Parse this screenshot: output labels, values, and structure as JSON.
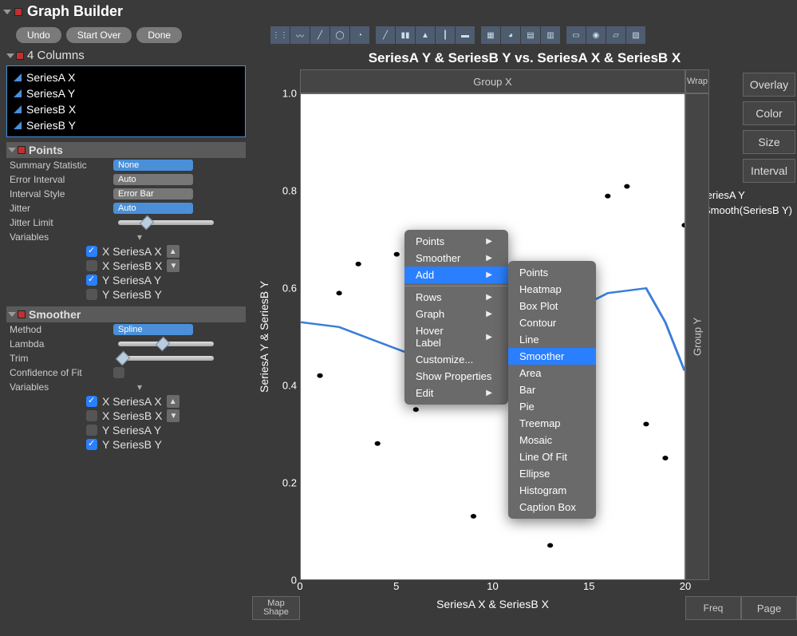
{
  "title": "Graph Builder",
  "buttons": {
    "undo": "Undo",
    "start_over": "Start Over",
    "done": "Done"
  },
  "columns_header": "4 Columns",
  "columns": [
    "SeriesA X",
    "SeriesA Y",
    "SeriesB X",
    "SeriesB Y"
  ],
  "points_panel": {
    "title": "Points",
    "summary_stat_label": "Summary Statistic",
    "summary_stat_value": "None",
    "error_interval_label": "Error Interval",
    "error_interval_value": "Auto",
    "interval_style_label": "Interval Style",
    "interval_style_value": "Error Bar",
    "jitter_label": "Jitter",
    "jitter_value": "Auto",
    "jitter_limit_label": "Jitter Limit",
    "variables_label": "Variables",
    "vars": [
      {
        "on": true,
        "label": "X SeriesA X",
        "dir": "up"
      },
      {
        "on": false,
        "label": "X SeriesB X",
        "dir": "down"
      },
      {
        "on": true,
        "label": "Y SeriesA Y",
        "dir": ""
      },
      {
        "on": false,
        "label": "Y SeriesB Y",
        "dir": ""
      }
    ]
  },
  "smoother_panel": {
    "title": "Smoother",
    "method_label": "Method",
    "method_value": "Spline",
    "lambda_label": "Lambda",
    "trim_label": "Trim",
    "confidence_label": "Confidence of Fit",
    "variables_label": "Variables",
    "vars": [
      {
        "on": true,
        "label": "X SeriesA X",
        "dir": "up"
      },
      {
        "on": false,
        "label": "X SeriesB X",
        "dir": "down"
      },
      {
        "on": false,
        "label": "Y SeriesA Y",
        "dir": ""
      },
      {
        "on": true,
        "label": "Y SeriesB Y",
        "dir": ""
      }
    ]
  },
  "plot": {
    "title": "SeriesA Y & SeriesB Y vs. SeriesA X & SeriesB X",
    "ylabel": "SeriesA Y & SeriesB Y",
    "xlabel": "SeriesA X & SeriesB X",
    "group_x": "Group X",
    "group_y": "Group Y",
    "wrap": "Wrap",
    "freq": "Freq",
    "map_shape_1": "Map",
    "map_shape_2": "Shape",
    "overlay": "Overlay",
    "color": "Color",
    "size": "Size",
    "interval": "Interval",
    "page": "Page"
  },
  "legend": {
    "points": "SeriesA Y",
    "smooth": "Smooth(SeriesB Y)"
  },
  "ticks": {
    "y": [
      "0",
      "0.2",
      "0.4",
      "0.6",
      "0.8",
      "1.0"
    ],
    "x": [
      "0",
      "5",
      "10",
      "15",
      "20"
    ]
  },
  "context_menu_1": [
    {
      "label": "Points",
      "sub": true
    },
    {
      "label": "Smoother",
      "sub": true
    },
    {
      "label": "Add",
      "sub": true,
      "hl": true
    },
    {
      "sep": true
    },
    {
      "label": "Rows",
      "sub": true
    },
    {
      "label": "Graph",
      "sub": true
    },
    {
      "label": "Hover Label",
      "sub": true
    },
    {
      "label": "Customize...",
      "sub": false
    },
    {
      "label": "Show Properties",
      "sub": false
    },
    {
      "label": "Edit",
      "sub": true
    }
  ],
  "context_menu_2": [
    "Points",
    "Heatmap",
    "Box Plot",
    "Contour",
    "Line",
    "Smoother",
    "Area",
    "Bar",
    "Pie",
    "Treemap",
    "Mosaic",
    "Line Of Fit",
    "Ellipse",
    "Histogram",
    "Caption Box"
  ],
  "context_menu_2_highlight": "Smoother",
  "chart_data": {
    "type": "scatter",
    "title": "SeriesA Y & SeriesB Y vs. SeriesA X & SeriesB X",
    "xlabel": "SeriesA X & SeriesB X",
    "ylabel": "SeriesA Y & SeriesB Y",
    "xlim": [
      0,
      20
    ],
    "ylim": [
      0,
      1.0
    ],
    "series": [
      {
        "name": "SeriesA Y",
        "type": "points",
        "x": [
          1.0,
          2.0,
          3.0,
          4.0,
          5.0,
          6.0,
          6.8,
          7.0,
          8.0,
          9.0,
          10.0,
          11.0,
          12.0,
          13.0,
          13.5,
          15.0,
          16.0,
          17.0,
          18.0,
          19.0,
          20.0
        ],
        "y": [
          0.42,
          0.59,
          0.65,
          0.28,
          0.67,
          0.35,
          0.71,
          0.56,
          0.38,
          0.13,
          0.6,
          0.25,
          0.21,
          0.07,
          0.58,
          0.15,
          0.79,
          0.81,
          0.32,
          0.25,
          0.73
        ]
      },
      {
        "name": "Smooth(SeriesB Y)",
        "type": "line",
        "x": [
          0,
          2,
          4,
          6,
          8,
          10,
          12,
          14,
          16,
          18,
          19,
          20
        ],
        "y": [
          0.53,
          0.52,
          0.49,
          0.46,
          0.46,
          0.47,
          0.51,
          0.55,
          0.59,
          0.6,
          0.53,
          0.43
        ]
      }
    ]
  }
}
